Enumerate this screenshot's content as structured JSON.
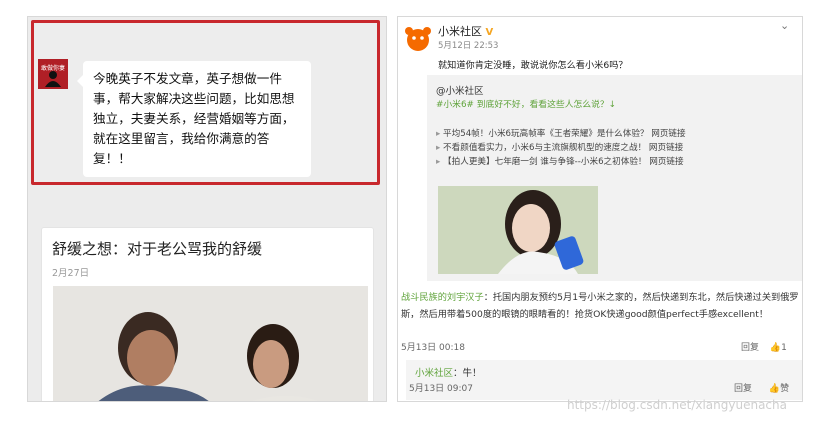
{
  "wechat": {
    "avatar_text": "敢做你妻",
    "message": "今晚英子不发文章，英子想做一件事，帮大家解决这些问题，比如思想独立，夫妻关系，经营婚姻等方面，就在这里留言，我给你满意的答复！！"
  },
  "article": {
    "title": "舒缓之想：对于老公骂我的舒缓",
    "date": "2月27日"
  },
  "weibo": {
    "name": "小米社区",
    "time": "5月12日 22:53",
    "text": "就知道你肯定没睡，敢说说你怎么看小米6吗？",
    "repost": {
      "name": "@小米社区",
      "line": "#小米6# 到底好不好，看看这些人怎么说？↓",
      "bullets": [
        "平均54帧！小米6玩高帧率《王者荣耀》是什么体验？ 网页链接",
        "不看颜值看实力，小米6与主流旗舰机型的速度之战！ 网页链接",
        "【拍人更美】七年磨一剑 谁与争锋--小米6之初体验！ 网页链接"
      ]
    },
    "comment1": {
      "user": "战斗民族的刘宇汉子",
      "text": "：托国内朋友预约5月1号小米之家的，然后快递到东北，然后快递过关到俄罗斯，然后用带着500度的眼镜的眼睛看的！抢货OK快递good颜值perfect手感excellent！",
      "time": "5月13日 00:18",
      "reply": "回复",
      "likes": "1"
    },
    "comment2": {
      "user": "小米社区",
      "text": "：牛！",
      "time": "5月13日 09:07",
      "reply": "回复",
      "like": "赞"
    }
  },
  "watermark": "https://blog.csdn.net/xiangyuenacha"
}
